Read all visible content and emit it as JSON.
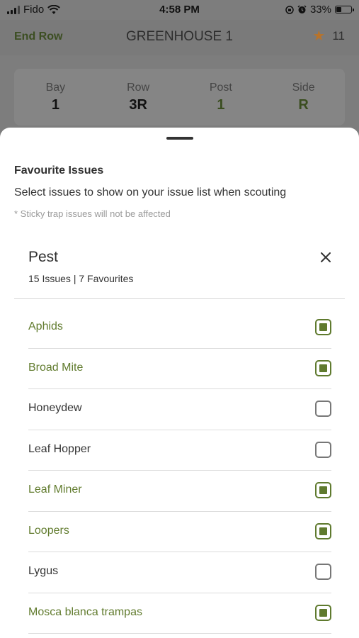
{
  "status_bar": {
    "carrier": "Fido",
    "time": "4:58 PM",
    "battery": "33%"
  },
  "header": {
    "left_action": "End Row",
    "title": "GREENHOUSE 1",
    "count": "11",
    "count_icon": "star-icon"
  },
  "location": [
    {
      "label": "Bay",
      "value": "1"
    },
    {
      "label": "Row",
      "value": "3R"
    },
    {
      "label": "Post",
      "value": "1"
    },
    {
      "label": "Side",
      "value": "R"
    }
  ],
  "sheet": {
    "title": "Favourite Issues",
    "subtitle": "Select issues to show on your issue list when scouting",
    "note": "* Sticky trap issues will not be affected",
    "group": {
      "title": "Pest",
      "summary": "15 Issues | 7 Favourites",
      "close_icon": "close-icon"
    },
    "issues": [
      {
        "label": "Aphids",
        "favourite": true
      },
      {
        "label": "Broad Mite",
        "favourite": true
      },
      {
        "label": "Honeydew",
        "favourite": false
      },
      {
        "label": "Leaf Hopper",
        "favourite": false
      },
      {
        "label": "Leaf Miner",
        "favourite": true
      },
      {
        "label": "Loopers",
        "favourite": true
      },
      {
        "label": "Lygus",
        "favourite": false
      },
      {
        "label": "Mosca blanca trampas",
        "favourite": true
      }
    ]
  },
  "colors": {
    "accent_green": "#627c2f",
    "star": "#e08a2a"
  }
}
